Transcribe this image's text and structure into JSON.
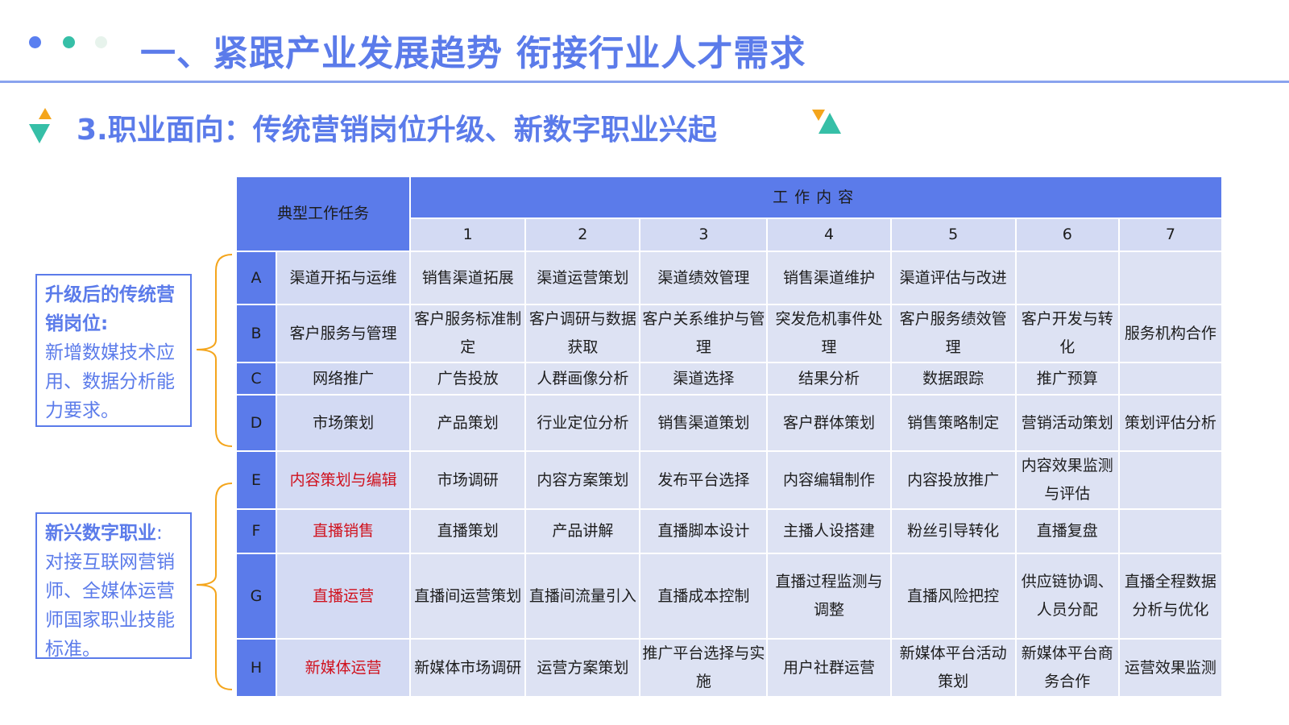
{
  "header": {
    "title": "一、紧跟产业发展趋势 衔接行业人才需求",
    "subtitle": "3.职业面向：传统营销岗位升级、新数字职业兴起"
  },
  "colors": {
    "accent": "#5b7bea",
    "teal": "#36bfa7",
    "orange": "#f4a51c",
    "red_text": "#d0121e",
    "header_cell": "#5b7bea",
    "light_cell": "#dde2f3"
  },
  "sidebar": {
    "upgraded": {
      "heading": "升级后的传统营销岗位:",
      "body": "新增数媒技术应用、数据分析能力要求。"
    },
    "emerging": {
      "heading": "新兴数字职业",
      "colon": ":",
      "body": "对接互联网营销师、全媒体运营师国家职业技能标准。"
    }
  },
  "table": {
    "task_header": "典型工作任务",
    "content_header": "工作内容",
    "columns": [
      "1",
      "2",
      "3",
      "4",
      "5",
      "6",
      "7"
    ],
    "rows": [
      {
        "letter": "A",
        "task": "渠道开拓与运维",
        "cells": [
          "销售渠道拓展",
          "渠道运营策划",
          "渠道绩效管理",
          "销售渠道维护",
          "渠道评估与改进",
          "",
          ""
        ]
      },
      {
        "letter": "B",
        "task": "客户服务与管理",
        "cells": [
          "客户服务标准制定",
          "客户调研与数据获取",
          "客户关系维护与管理",
          "突发危机事件处理",
          "客户服务绩效管理",
          "客户开发与转化",
          "服务机构合作"
        ]
      },
      {
        "letter": "C",
        "task": "网络推广",
        "cells": [
          "广告投放",
          "人群画像分析",
          "渠道选择",
          "结果分析",
          "数据跟踪",
          "推广预算",
          ""
        ]
      },
      {
        "letter": "D",
        "task": "市场策划",
        "cells": [
          "产品策划",
          "行业定位分析",
          "销售渠道策划",
          "客户群体策划",
          "销售策略制定",
          "营销活动策划",
          "策划评估分析"
        ]
      },
      {
        "letter": "E",
        "task": "内容策划与编辑",
        "cells": [
          "市场调研",
          "内容方案策划",
          "发布平台选择",
          "内容编辑制作",
          "内容投放推广",
          "内容效果监测与评估",
          ""
        ]
      },
      {
        "letter": "F",
        "task": "直播销售",
        "cells": [
          "直播策划",
          "产品讲解",
          "直播脚本设计",
          "主播人设搭建",
          "粉丝引导转化",
          "直播复盘",
          ""
        ]
      },
      {
        "letter": "G",
        "task": "直播运营",
        "cells": [
          "直播间运营策划",
          "直播间流量引入",
          "直播成本控制",
          "直播过程监测与调整",
          "直播风险把控",
          "供应链协调、人员分配",
          "直播全程数据分析与优化"
        ]
      },
      {
        "letter": "H",
        "task": "新媒体运营",
        "cells": [
          "新媒体市场调研",
          "运营方案策划",
          "推广平台选择与实施",
          "用户社群运营",
          "新媒体平台活动策划",
          "新媒体平台商务合作",
          "运营效果监测"
        ]
      }
    ]
  }
}
